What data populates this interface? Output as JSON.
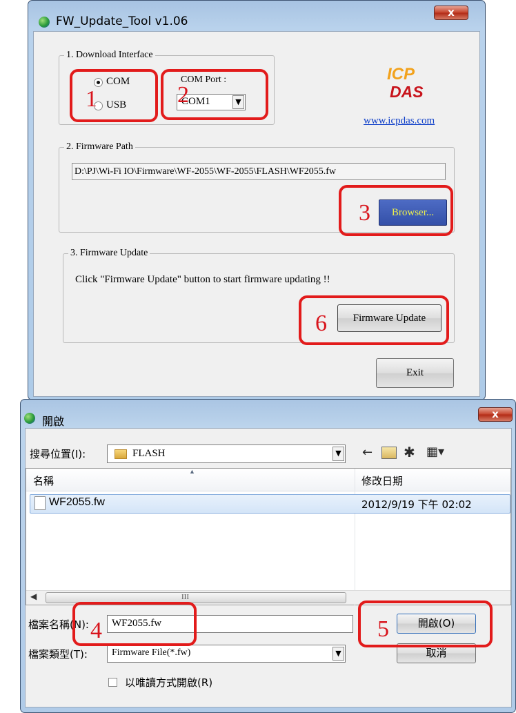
{
  "fw_window": {
    "title": "FW_Update_Tool v1.06",
    "close_glyph": "x",
    "download_interface": {
      "label": "1. Download Interface",
      "radio_com": "COM",
      "radio_usb": "USB",
      "selected": "COM",
      "com_port_label": "COM Port :",
      "com_port_value": "COM1"
    },
    "logo": {
      "line1": "ICP",
      "line2": "DAS",
      "link": "www.icpdas.com"
    },
    "firmware_path": {
      "label": "2. Firmware Path",
      "value": "D:\\PJ\\Wi-Fi IO\\Firmware\\WF-2055\\WF-2055\\FLASH\\WF2055.fw",
      "browse_button": "Browser..."
    },
    "firmware_update": {
      "label": "3. Firmware Update",
      "instruction": "Click  \"Firmware Update\" button to start firmware updating !!",
      "update_button": "Firmware Update"
    },
    "exit_button": "Exit"
  },
  "open_dialog": {
    "title": "開啟",
    "close_glyph": "x",
    "look_in_label": "搜尋位置(I):",
    "look_in_value": "FLASH",
    "columns": {
      "name": "名稱",
      "modified": "修改日期"
    },
    "files": [
      {
        "name": "WF2055.fw",
        "modified": "2012/9/19 下午 02:02"
      }
    ],
    "scroll_mark": "III",
    "filename_label": "檔案名稱(N):",
    "filename_value": "WF2055.fw",
    "filetype_label": "檔案類型(T):",
    "filetype_value": "Firmware File(*.fw)",
    "open_button": "開啟(O)",
    "cancel_button": "取消",
    "readonly_label": "以唯讀方式開啟(R)"
  },
  "annotations": {
    "step1": "1",
    "step2": "2",
    "step3": "3",
    "step4": "4",
    "step5": "5",
    "step6": "6",
    "color": "#e21b1b"
  }
}
